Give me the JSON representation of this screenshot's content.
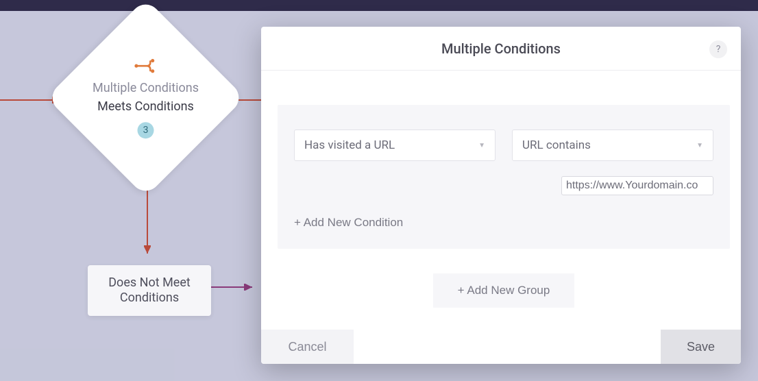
{
  "flow": {
    "diamond": {
      "title": "Multiple Conditions",
      "subtitle": "Meets Conditions",
      "badge": "3"
    },
    "rect": {
      "label": "Does Not Meet\nConditions"
    }
  },
  "modal": {
    "title": "Multiple Conditions",
    "help_label": "?",
    "group": {
      "condition_type": "Has visited a URL",
      "match_type": "URL contains",
      "url_value": "https://www.Yourdomain.co",
      "add_condition_label": "+ Add New Condition"
    },
    "add_group_label": "+ Add New Group",
    "cancel_label": "Cancel",
    "save_label": "Save"
  },
  "colors": {
    "accent": "#e07a3a",
    "dark_bar": "#2f2b4a"
  }
}
